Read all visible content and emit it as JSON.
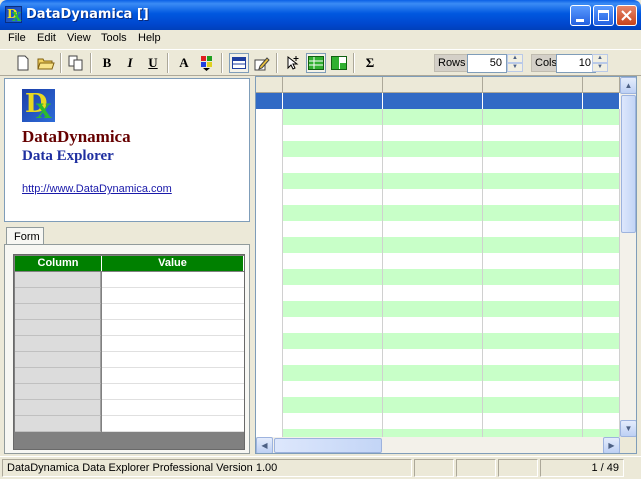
{
  "window": {
    "title": "DataDynamica []"
  },
  "menu": [
    "File",
    "Edit",
    "View",
    "Tools",
    "Help"
  ],
  "toolbar": {
    "bold": "B",
    "italic": "I",
    "underline": "U",
    "font": "A",
    "sum": "Σ",
    "rows_label": "Rows",
    "rows_value": "50",
    "cols_label": "Cols",
    "cols_value": "10"
  },
  "info": {
    "title": "DataDynamica",
    "subtitle": "Data Explorer",
    "link": "http://www.DataDynamica.com"
  },
  "form": {
    "tab": "Form",
    "col_header": "Column",
    "val_header": "Value"
  },
  "status": {
    "text": "DataDynamica Data Explorer Professional Version 1.00",
    "position": "1 / 49"
  },
  "colors": {
    "accent": "#316AC5",
    "grid_alt": "#C8FFC8",
    "form_header": "#008000"
  }
}
